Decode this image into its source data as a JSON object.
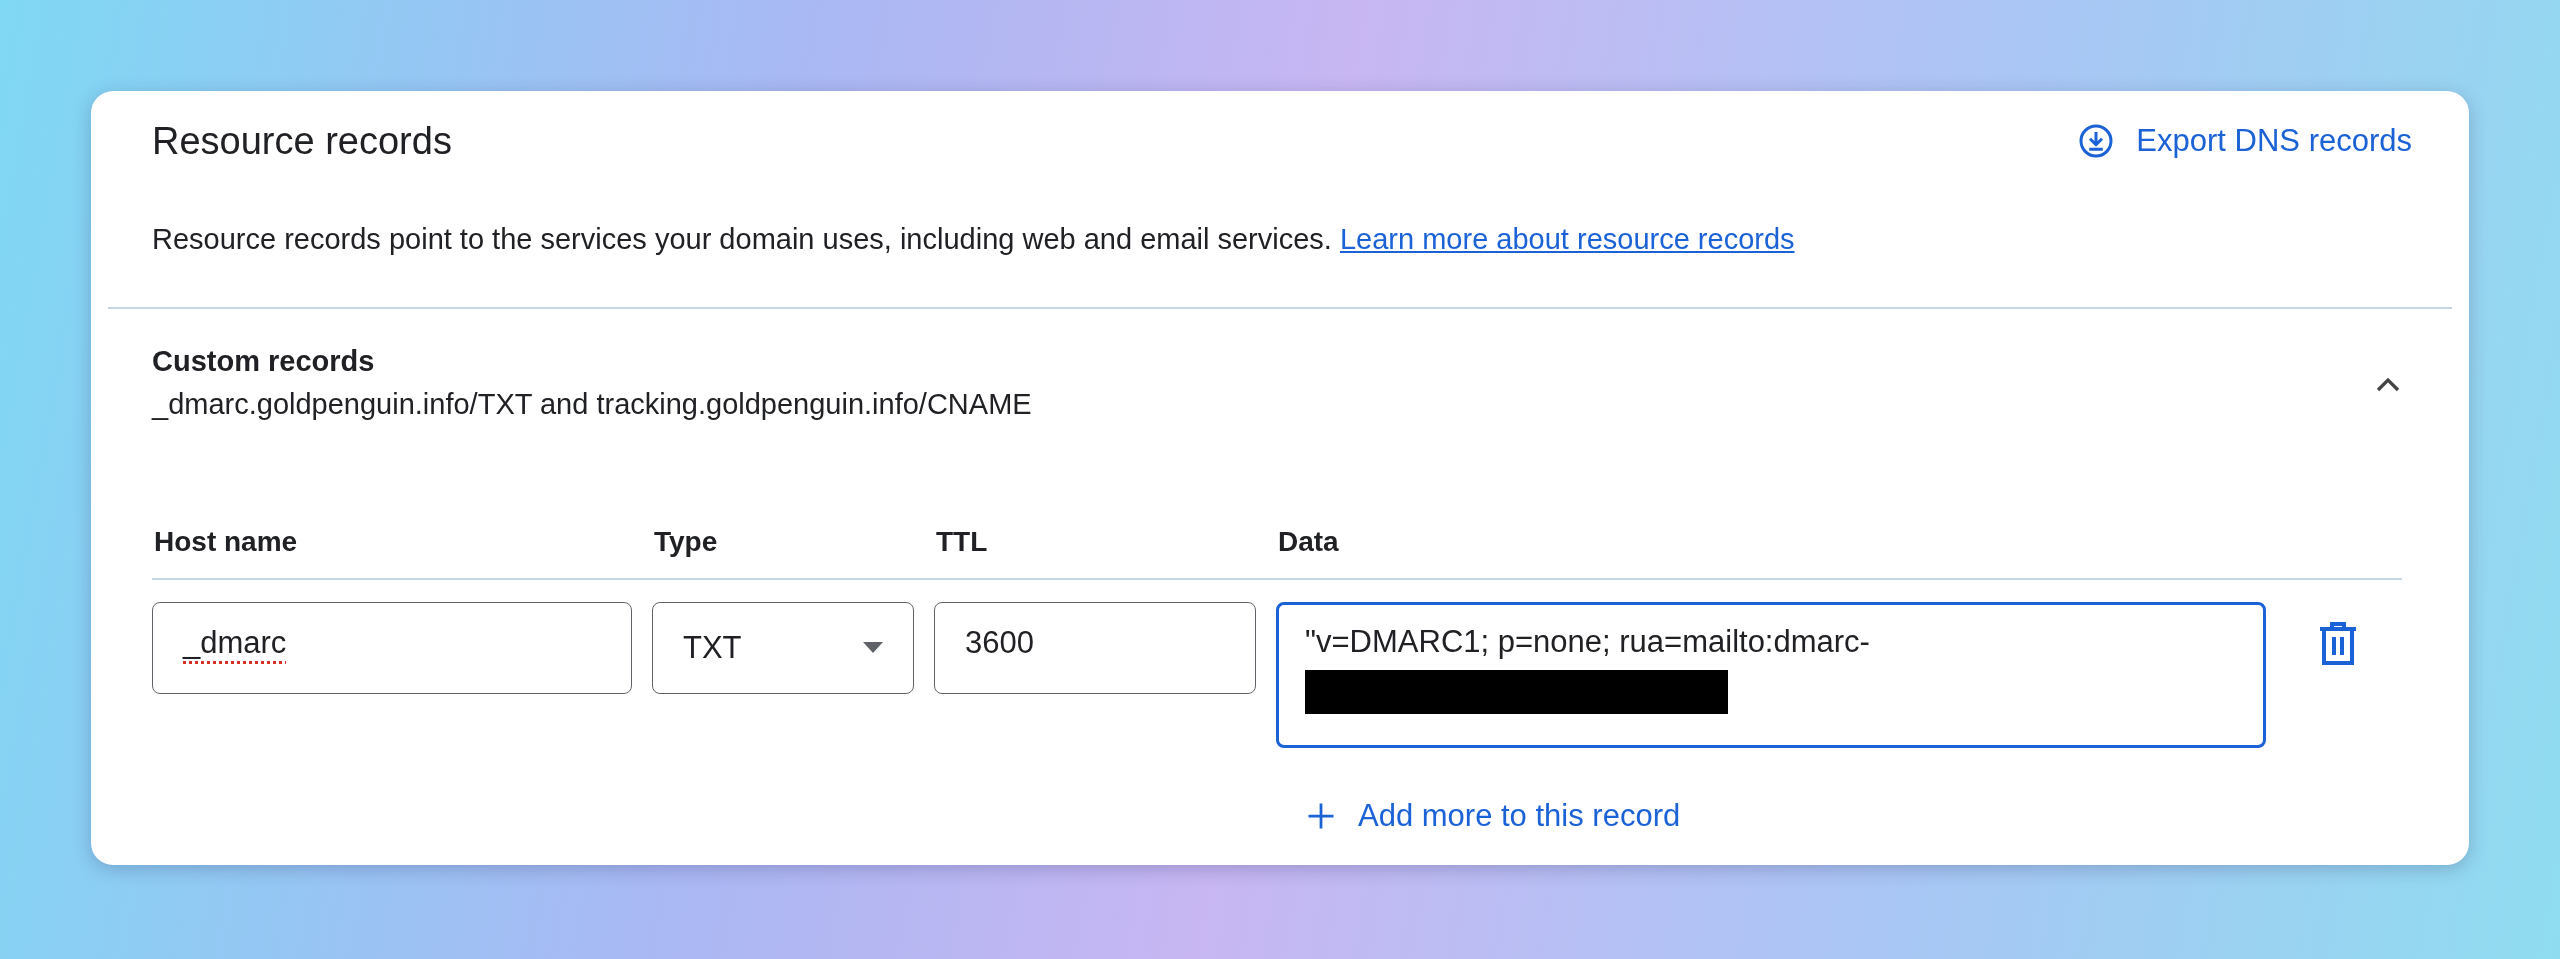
{
  "card": {
    "title": "Resource records",
    "export_link": "Export DNS records",
    "description": "Resource records point to the services your domain uses, including web and email services.",
    "learn_more_link": "Learn more about resource records"
  },
  "custom_records": {
    "title": "Custom records",
    "summary": "_dmarc.goldpenguin.info/TXT and tracking.goldpenguin.info/CNAME",
    "expanded": true,
    "columns": [
      "Host name",
      "Type",
      "TTL",
      "Data"
    ],
    "record": {
      "host": {
        "value": "_dmarc",
        "spelling_error": true
      },
      "type": {
        "value": "TXT"
      },
      "ttl": {
        "value": "3600"
      },
      "data": {
        "value": "\"v=DMARC1; p=none; rua=mailto:dmarc-",
        "redacted": true,
        "focused": true
      }
    },
    "add_more_link": "Add more to this record"
  }
}
